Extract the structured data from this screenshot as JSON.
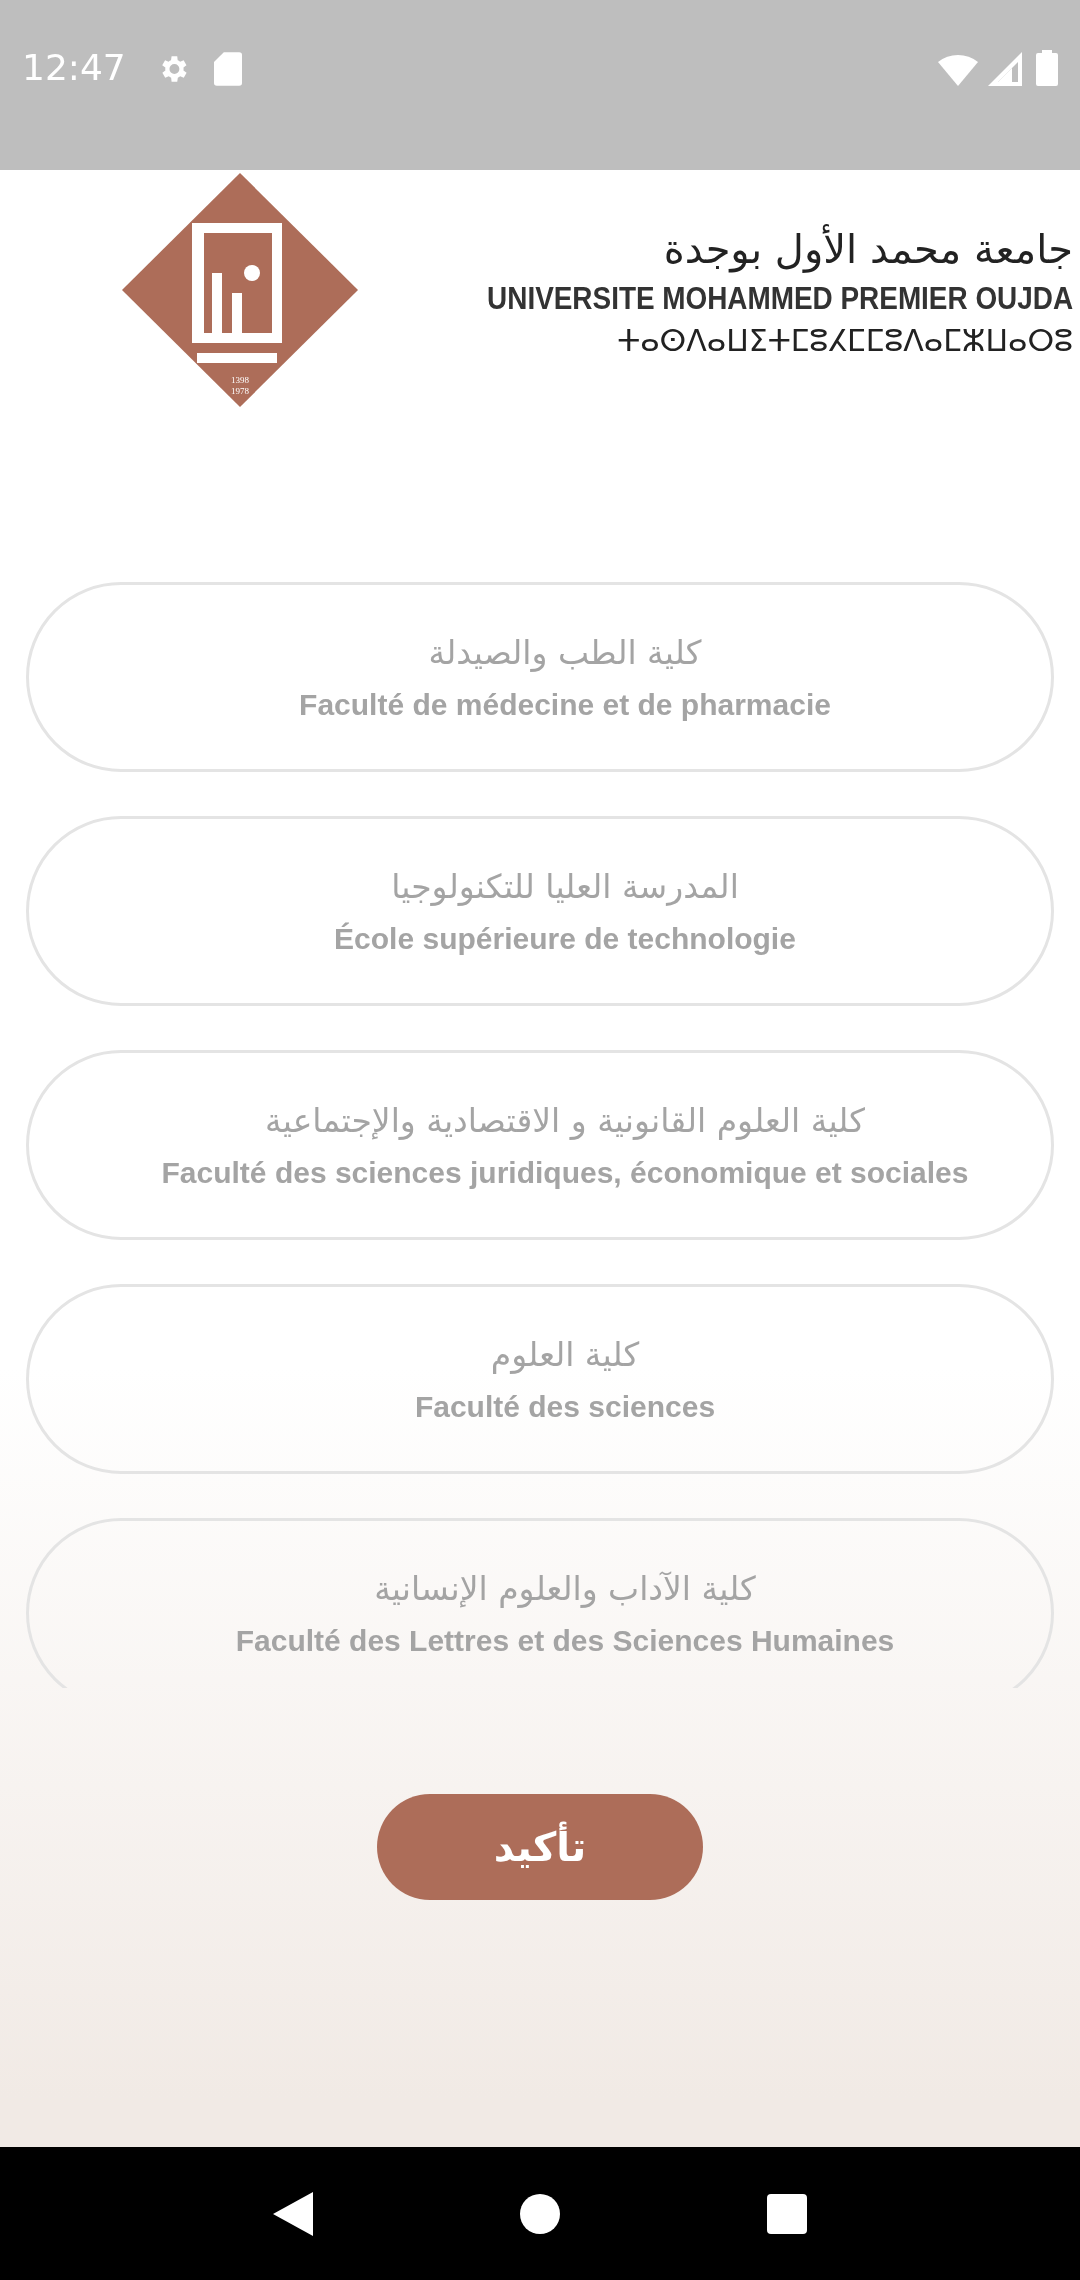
{
  "status_bar": {
    "time": "12:47"
  },
  "header": {
    "logo_years": [
      "1398",
      "1978"
    ],
    "arabic_name": "جامعة محمد الأول بوجدة",
    "latin_name": "UNIVERSITE MOHAMMED PREMIER OUJDA",
    "tifinagh_name": "ⵜⴰⵙⴷⴰⵡⵉⵜⵎⵓⵃⵎⵎⵓⴷⴰⵎⵣⵡⴰⵔⵓ"
  },
  "faculties": [
    {
      "arabic": "كلية الطب والصيدلة",
      "french": "Faculté de médecine et de pharmacie"
    },
    {
      "arabic": "المدرسة العليا للتكنولوجيا",
      "french": "École supérieure de technologie"
    },
    {
      "arabic": "كلية العلوم القانونية و الاقتصادية والإجتماعية",
      "french": "Faculté des sciences juridiques, économique et sociales"
    },
    {
      "arabic": "كلية العلوم",
      "french": "Faculté des sciences"
    },
    {
      "arabic": "كلية الآداب والعلوم الإنسانية",
      "french": "Faculté des Lettres et des Sciences Humaines"
    }
  ],
  "confirm_button": {
    "label": "تأكيد"
  }
}
